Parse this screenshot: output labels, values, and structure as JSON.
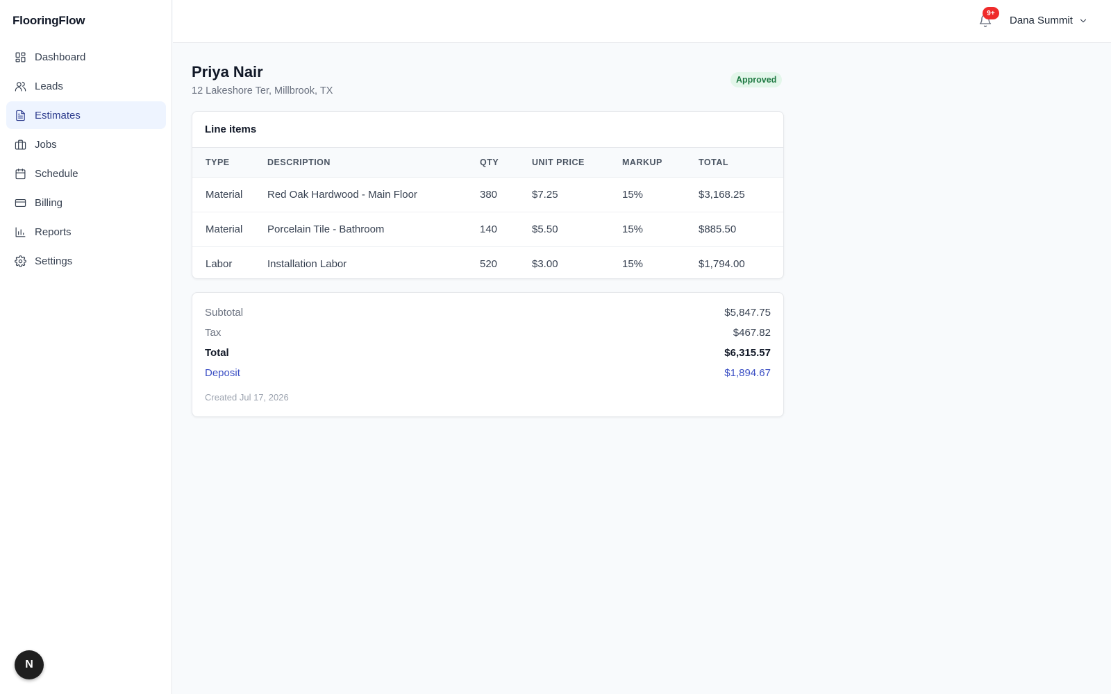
{
  "app": {
    "brand": "FlooringFlow"
  },
  "sidebar": {
    "items": [
      {
        "label": "Dashboard",
        "icon": "dashboard-icon"
      },
      {
        "label": "Leads",
        "icon": "users-icon"
      },
      {
        "label": "Estimates",
        "icon": "document-icon",
        "active": true
      },
      {
        "label": "Jobs",
        "icon": "briefcase-icon"
      },
      {
        "label": "Schedule",
        "icon": "calendar-icon"
      },
      {
        "label": "Billing",
        "icon": "credit-card-icon"
      },
      {
        "label": "Reports",
        "icon": "bar-chart-icon"
      },
      {
        "label": "Settings",
        "icon": "gear-icon"
      }
    ],
    "footer_badge": "N"
  },
  "header": {
    "notifications_count": "9+",
    "user_name": "Dana Summit"
  },
  "estimate": {
    "customer_name": "Priya Nair",
    "address": "12 Lakeshore Ter, Millbrook, TX",
    "status": "Approved",
    "line_items_title": "Line items",
    "columns": [
      "TYPE",
      "DESCRIPTION",
      "QTY",
      "UNIT PRICE",
      "MARKUP",
      "TOTAL"
    ],
    "rows": [
      [
        "Material",
        "Red Oak Hardwood - Main Floor",
        "380",
        "$7.25",
        "15%",
        "$3,168.25"
      ],
      [
        "Material",
        "Porcelain Tile - Bathroom",
        "140",
        "$5.50",
        "15%",
        "$885.50"
      ],
      [
        "Labor",
        "Installation Labor",
        "520",
        "$3.00",
        "15%",
        "$1,794.00"
      ]
    ],
    "summary": {
      "subtotal_label": "Subtotal",
      "subtotal": "$5,847.75",
      "tax_label": "Tax",
      "tax": "$467.82",
      "total_label": "Total",
      "total": "$6,315.57",
      "deposit_label": "Deposit",
      "deposit": "$1,894.67",
      "created": "Created Jul 17, 2026"
    }
  },
  "colors": {
    "active_nav_bg": "#eef4ff",
    "active_nav_text": "#2f3e8f",
    "status_bg": "#e3f6ea",
    "status_text": "#1f7a43",
    "deposit": "#3b4fc4",
    "notification": "#ef2b2b"
  }
}
